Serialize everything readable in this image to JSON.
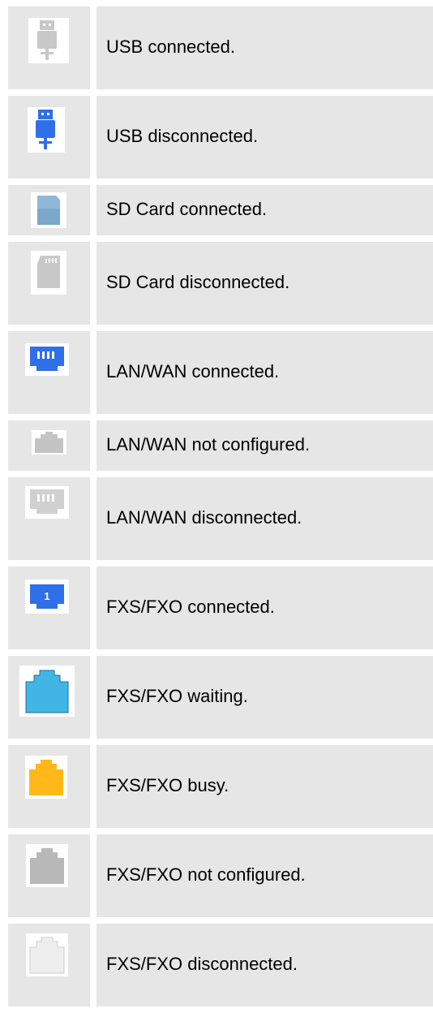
{
  "legend": {
    "rows": [
      {
        "icon": "usb-connected-icon",
        "label": "USB connected."
      },
      {
        "icon": "usb-disconnected-icon",
        "label": "USB disconnected."
      },
      {
        "icon": "sd-card-connected-icon",
        "label": "SD Card connected."
      },
      {
        "icon": "sd-card-disconnected-icon",
        "label": "SD Card disconnected."
      },
      {
        "icon": "lan-wan-connected-icon",
        "label": "LAN/WAN connected."
      },
      {
        "icon": "lan-wan-not-configured-icon",
        "label": "LAN/WAN not configured."
      },
      {
        "icon": "lan-wan-disconnected-icon",
        "label": "LAN/WAN disconnected."
      },
      {
        "icon": "fxs-fxo-connected-icon",
        "label": "FXS/FXO connected.",
        "badge": "1"
      },
      {
        "icon": "fxs-fxo-waiting-icon",
        "label": "FXS/FXO waiting."
      },
      {
        "icon": "fxs-fxo-busy-icon",
        "label": "FXS/FXO busy."
      },
      {
        "icon": "fxs-fxo-not-configured-icon",
        "label": "FXS/FXO not configured."
      },
      {
        "icon": "fxs-fxo-disconnected-icon",
        "label": "FXS/FXO disconnected."
      }
    ]
  },
  "colors": {
    "cell_background": "#e6e6e6",
    "usb_gray": "#c8c8c8",
    "usb_blue": "#2f6fe8",
    "sd_blue": "#8fb8d8",
    "sd_gray": "#c8c8c8",
    "port_blue": "#2f6fe8",
    "port_gray": "#c4c4c4",
    "port_light_gray": "#d0d0d0",
    "fxs_blue": "#2f6fe8",
    "fxs_waiting": "#41b6e6",
    "fxs_busy": "#ffb81a",
    "fxs_not_configured": "#b8b8b8",
    "fxs_disconnected": "#eeeeee"
  }
}
